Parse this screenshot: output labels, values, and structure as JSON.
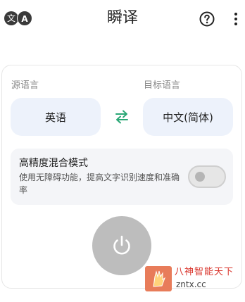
{
  "header": {
    "badge_left": "文",
    "badge_right": "A",
    "title": "瞬译"
  },
  "languages": {
    "source_caption": "源语言",
    "target_caption": "目标语言",
    "source_value": "英语",
    "target_value": "中文(简体)"
  },
  "mode": {
    "title": "高精度混合模式",
    "description": "使用无障碍功能，提高文字识别速度和准确率",
    "enabled": false
  },
  "watermark": {
    "line1": "八神智能天下",
    "line2": "zntx.cc"
  },
  "icons": {
    "badge": "translate-icon",
    "help": "help-circle-icon",
    "more": "more-vert-icon",
    "swap": "swap-arrows-icon",
    "power": "power-icon"
  },
  "colors": {
    "accent": "#2aa876",
    "lang_box_bg": "#edf2fb",
    "power_bg": "#bdbdbd",
    "watermark_red": "#d9342b"
  }
}
